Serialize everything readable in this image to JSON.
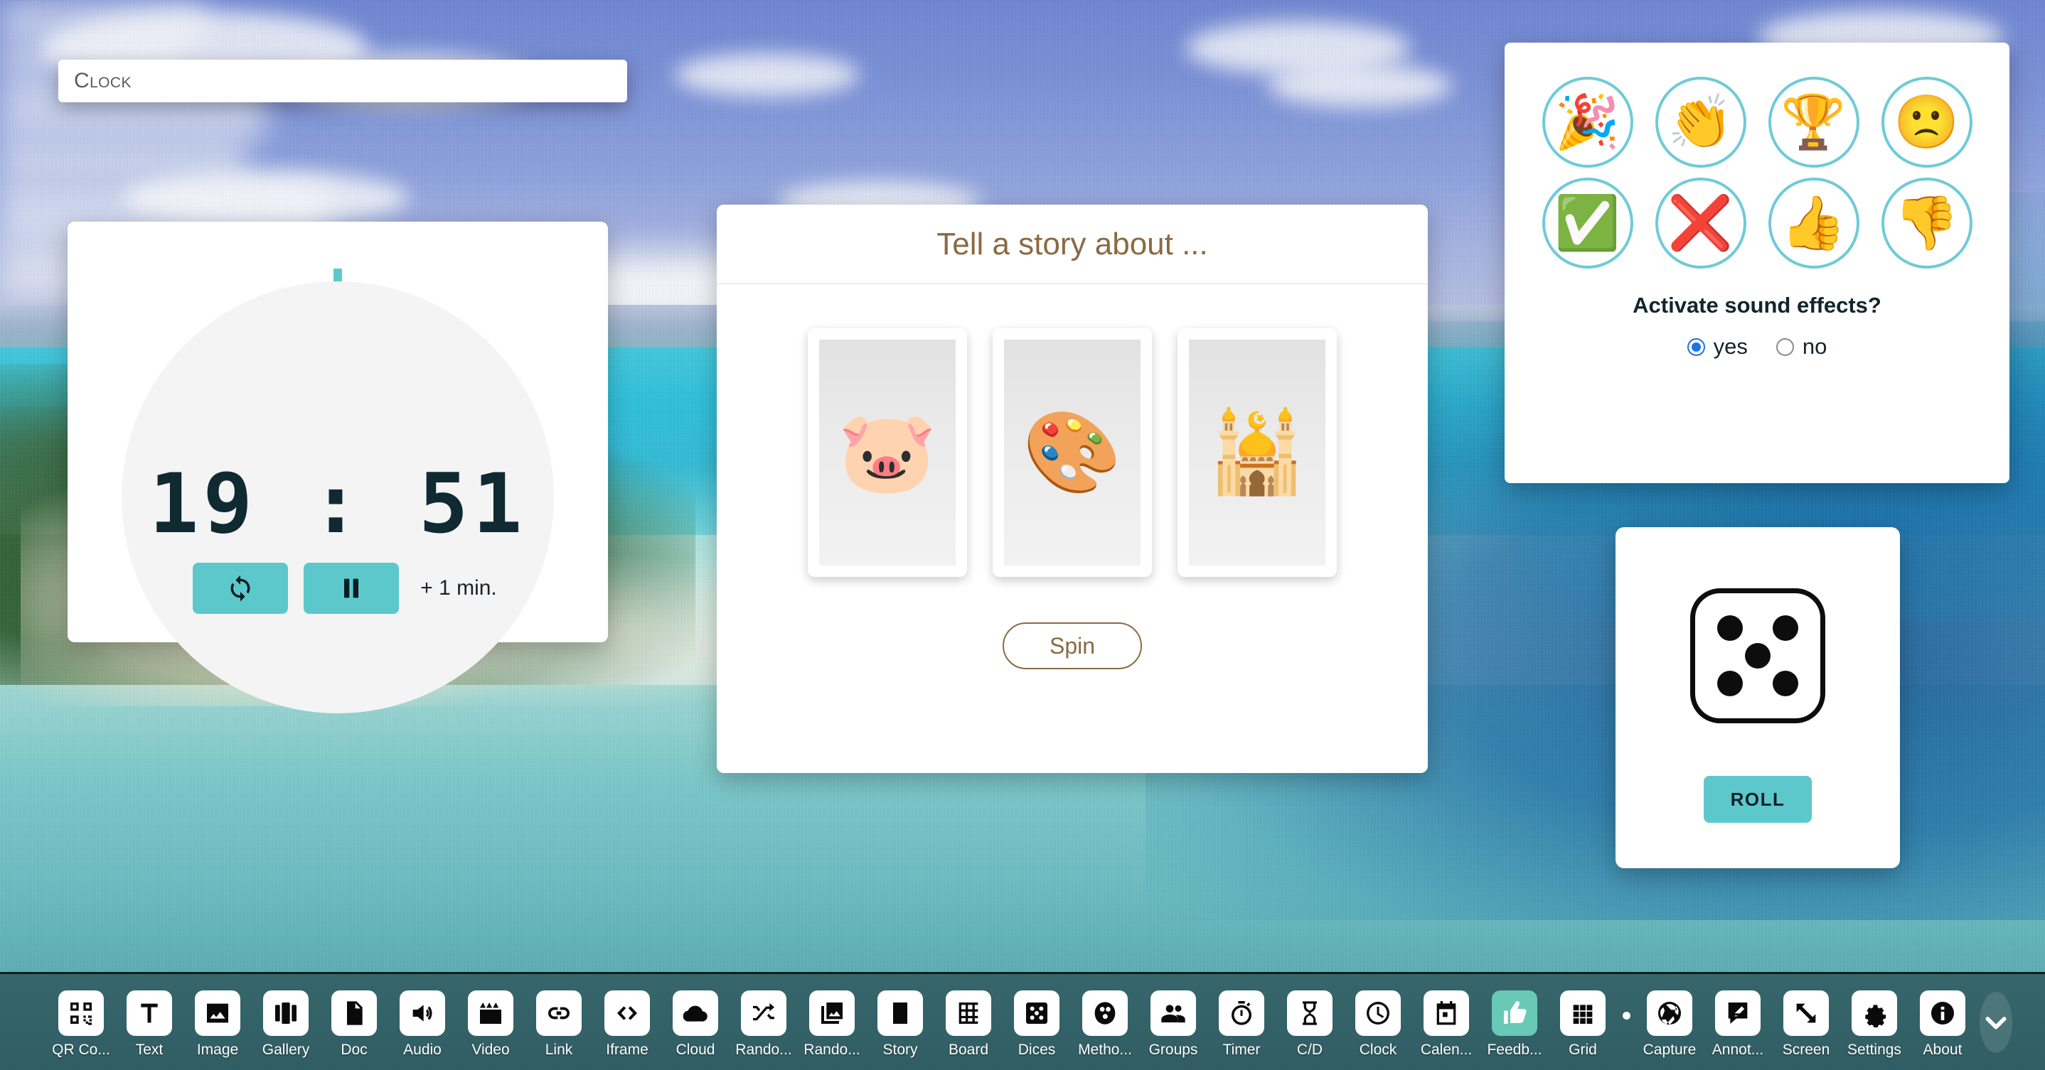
{
  "theme": {
    "accent_teal": "#5cc8cc",
    "dock_accent": "#68c9b6",
    "story_brown": "#8a6a42",
    "feedback_ring": "#6ecbd8",
    "radio_blue": "#1a73e8"
  },
  "title_field": {
    "value": "Clock",
    "placeholder": "Clock"
  },
  "timer": {
    "name": "Timer",
    "minutes": "19",
    "separator": ":",
    "seconds": "51",
    "display": "19 : 51",
    "reset_icon": "loop-icon",
    "pause_icon": "pause-icon",
    "add_minute_label": "+ 1 min."
  },
  "story": {
    "title": "Tell a story about ...",
    "cards": [
      {
        "name": "pig-face",
        "emoji": "🐷"
      },
      {
        "name": "artist-palette",
        "emoji": "🎨"
      },
      {
        "name": "mosque",
        "emoji": "🕌"
      }
    ],
    "spin_label": "Spin"
  },
  "feedback": {
    "buttons": [
      {
        "name": "party-popper",
        "emoji": "🎉"
      },
      {
        "name": "clapping-hands",
        "emoji": "👏"
      },
      {
        "name": "trophy",
        "emoji": "🏆"
      },
      {
        "name": "frowning-face",
        "emoji": "🙁"
      },
      {
        "name": "check-mark",
        "emoji": "✅"
      },
      {
        "name": "cross-mark",
        "emoji": "❌"
      },
      {
        "name": "thumbs-up",
        "emoji": "👍"
      },
      {
        "name": "thumbs-down",
        "emoji": "👎"
      }
    ],
    "question": "Activate sound effects?",
    "options": [
      {
        "label": "yes",
        "selected": true
      },
      {
        "label": "no",
        "selected": false
      }
    ]
  },
  "dice": {
    "value": 5,
    "roll_label": "ROLL"
  },
  "taskbar": {
    "items": [
      {
        "label": "QR Co...",
        "icon": "qr-code-icon",
        "accent": false
      },
      {
        "label": "Text",
        "icon": "text-icon",
        "accent": false
      },
      {
        "label": "Image",
        "icon": "image-icon",
        "accent": false
      },
      {
        "label": "Gallery",
        "icon": "gallery-icon",
        "accent": false
      },
      {
        "label": "Doc",
        "icon": "document-icon",
        "accent": false
      },
      {
        "label": "Audio",
        "icon": "speaker-icon",
        "accent": false
      },
      {
        "label": "Video",
        "icon": "clapperboard-icon",
        "accent": false
      },
      {
        "label": "Link",
        "icon": "link-icon",
        "accent": false
      },
      {
        "label": "Iframe",
        "icon": "code-brackets-icon",
        "accent": false
      },
      {
        "label": "Cloud",
        "icon": "cloud-icon",
        "accent": false
      },
      {
        "label": "Rando...",
        "icon": "shuffle-icon",
        "accent": false
      },
      {
        "label": "Rando...",
        "icon": "random-image-icon",
        "accent": false
      },
      {
        "label": "Story",
        "icon": "story-icon",
        "accent": false
      },
      {
        "label": "Board",
        "icon": "board-grid-icon",
        "accent": false
      },
      {
        "label": "Dices",
        "icon": "dice-icon",
        "accent": false
      },
      {
        "label": "Metho...",
        "icon": "methods-icon",
        "accent": false
      },
      {
        "label": "Groups",
        "icon": "groups-icon",
        "accent": false
      },
      {
        "label": "Timer",
        "icon": "stopwatch-icon",
        "accent": false
      },
      {
        "label": "C/D",
        "icon": "hourglass-icon",
        "accent": false
      },
      {
        "label": "Clock",
        "icon": "clock-icon",
        "accent": false
      },
      {
        "label": "Calen...",
        "icon": "calendar-icon",
        "accent": false
      },
      {
        "label": "Feedb...",
        "icon": "thumbs-up-icon",
        "accent": true
      },
      {
        "label": "Grid",
        "icon": "grid-icon",
        "accent": false
      },
      {
        "separator": true
      },
      {
        "label": "Capture",
        "icon": "camera-shutter-icon",
        "accent": false
      },
      {
        "label": "Annot...",
        "icon": "annotate-icon",
        "accent": false
      },
      {
        "label": "Screen",
        "icon": "fullscreen-icon",
        "accent": false
      },
      {
        "label": "Settings",
        "icon": "gear-icon",
        "accent": false
      },
      {
        "label": "About",
        "icon": "info-icon",
        "accent": false
      }
    ],
    "collapse_icon": "chevron-down-icon"
  }
}
